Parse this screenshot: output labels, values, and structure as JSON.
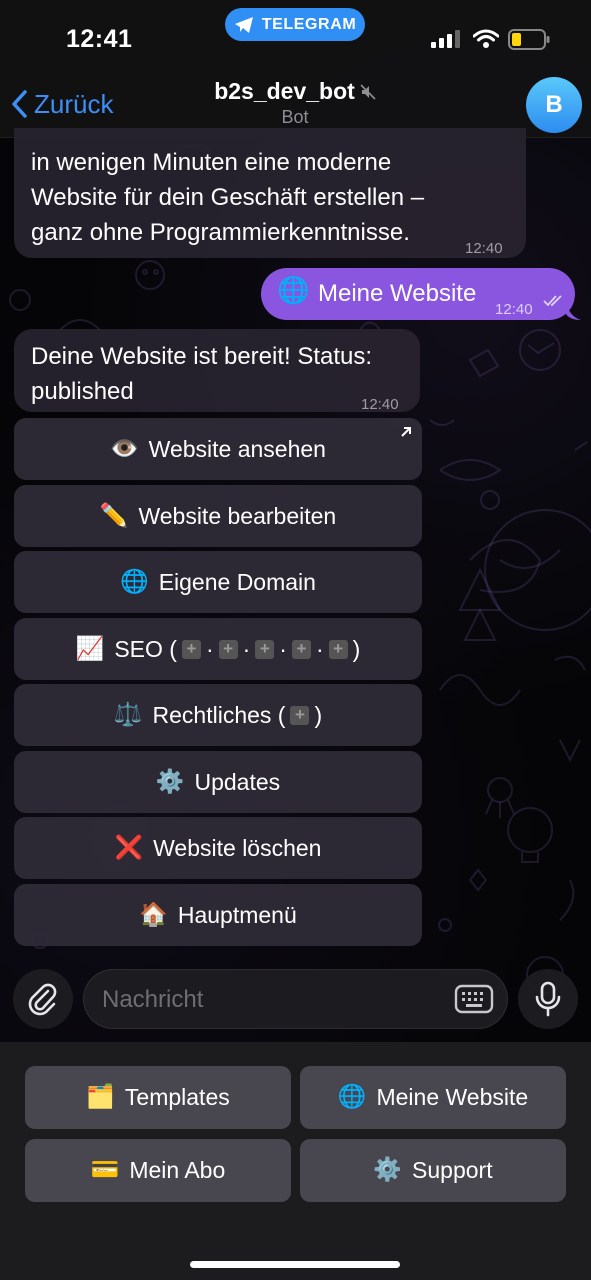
{
  "status_bar": {
    "time": "12:41",
    "app_pill": "TELEGRAM"
  },
  "nav": {
    "back_label": "Zurück",
    "title": "b2s_dev_bot",
    "subtitle": "Bot",
    "avatar_letter": "B"
  },
  "messages": [
    {
      "direction": "in",
      "lines": [
        "in wenigen Minuten eine moderne",
        "Website für dein Geschäft erstellen –",
        "ganz ohne Programmierkenntnisse."
      ],
      "time": "12:40"
    },
    {
      "direction": "out",
      "emoji": "🌐",
      "text": "Meine Website",
      "time": "12:40"
    },
    {
      "direction": "in",
      "lines": [
        "Deine Website ist bereit! Status:",
        "published"
      ],
      "time": "12:40"
    }
  ],
  "inline_keyboard": [
    {
      "emoji": "👁️",
      "label": "Website ansehen"
    },
    {
      "emoji": "✏️",
      "label": "Website bearbeiten"
    },
    {
      "emoji": "🌐",
      "label": "Eigene Domain"
    },
    {
      "emoji": "📈",
      "label": "SEO (",
      "label_end": ")"
    },
    {
      "emoji": "⚖️",
      "label": "Rechtliches (",
      "label_end": ")"
    },
    {
      "emoji": "⚙️",
      "label": "Updates"
    },
    {
      "emoji": "❌",
      "label": "Website löschen"
    },
    {
      "emoji": "🏠",
      "label": "Hauptmenü"
    }
  ],
  "input": {
    "placeholder": "Nachricht"
  },
  "reply_keyboard": [
    {
      "emoji": "🗂️",
      "label": "Templates"
    },
    {
      "emoji": "🌐",
      "label": "Meine Website"
    },
    {
      "emoji": "💳",
      "label": "Mein Abo"
    },
    {
      "emoji": "⚙️",
      "label": "Support"
    }
  ],
  "colors": {
    "accent": "#3e8ef7",
    "outgoing_bubble": "#8a56e0",
    "telegram_pill": "#2f8ff5"
  }
}
